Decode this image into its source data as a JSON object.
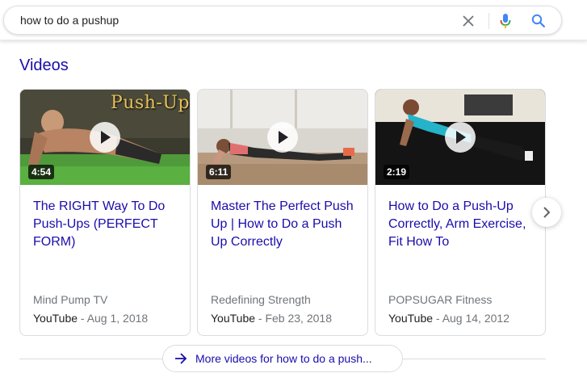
{
  "search": {
    "query": "how to do a pushup"
  },
  "videos": {
    "heading": "Videos",
    "items": [
      {
        "title": "The RIGHT Way To Do Push-Ups (PERFECT FORM)",
        "duration": "4:54",
        "thumbnail_text": "Push-Up",
        "channel": "Mind Pump TV",
        "source": "YouTube",
        "date": "Aug 1, 2018"
      },
      {
        "title": "Master The Perfect Push Up | How to Do a Push Up Correctly",
        "duration": "6:11",
        "channel": "Redefining Strength",
        "source": "YouTube",
        "date": "Feb 23, 2018"
      },
      {
        "title": "How to Do a Push-Up Correctly, Arm Exercise, Fit How To",
        "duration": "2:19",
        "channel": "POPSUGAR Fitness",
        "source": "YouTube",
        "date": "Aug 14, 2012"
      }
    ],
    "more_label": "More videos for how to do a push..."
  },
  "icons": {
    "clear": "close-icon",
    "mic": "microphone-icon",
    "search": "search-icon",
    "play": "play-icon",
    "next": "chevron-right-icon",
    "more": "arrow-right-icon"
  },
  "colors": {
    "link": "#1a0dab",
    "meta": "#70757a",
    "search_blue": "#4285f4"
  }
}
